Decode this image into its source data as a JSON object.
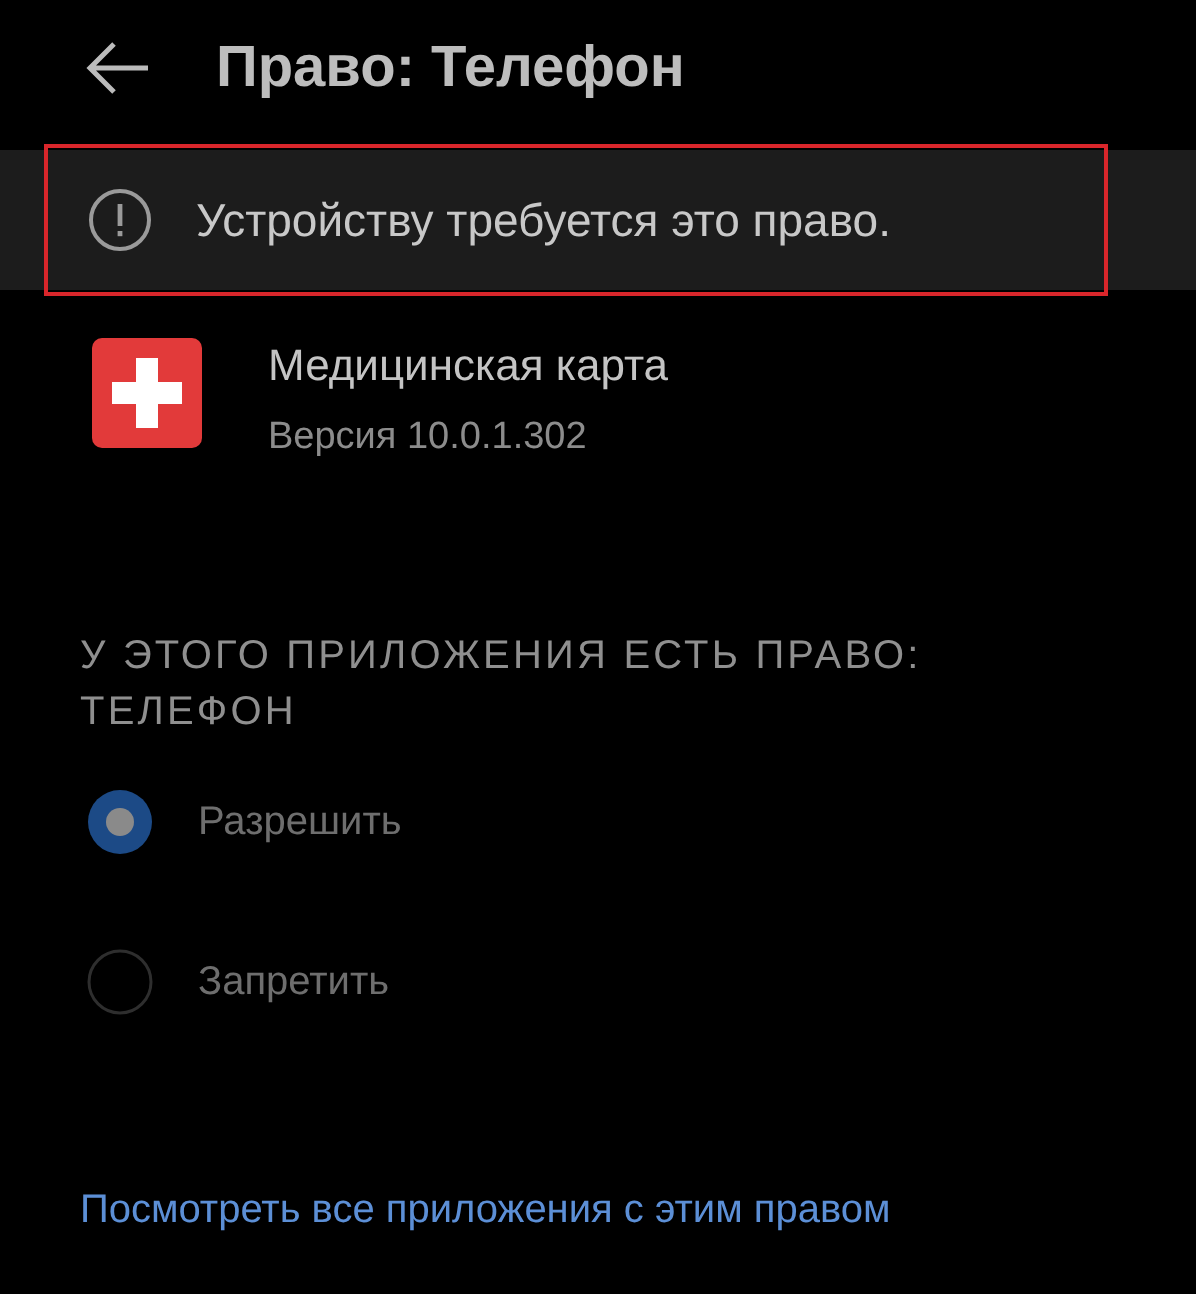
{
  "header": {
    "title": "Право: Телефон"
  },
  "notice": {
    "text": "Устройству требуется это право.",
    "highlighted": true
  },
  "app": {
    "name": "Медицинская карта",
    "version": "Версия 10.0.1.302"
  },
  "section": {
    "title": "У ЭТОГО ПРИЛОЖЕНИЯ ЕСТЬ ПРАВО: ТЕЛЕФОН"
  },
  "options": [
    {
      "label": "Разрешить",
      "selected": true,
      "disabled": true
    },
    {
      "label": "Запретить",
      "selected": false,
      "disabled": true
    }
  ],
  "link": {
    "text": "Посмотреть все приложения с этим правом"
  }
}
